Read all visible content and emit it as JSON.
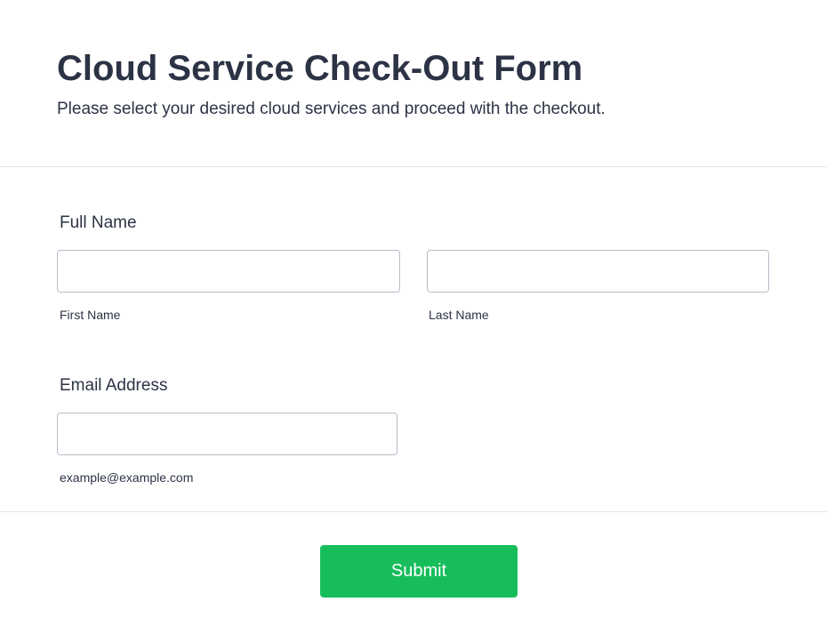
{
  "header": {
    "title": "Cloud Service Check-Out Form",
    "subtitle": "Please select your desired cloud services and proceed with the checkout."
  },
  "full_name": {
    "label": "Full Name",
    "first_name": {
      "value": "",
      "sublabel": "First Name"
    },
    "last_name": {
      "value": "",
      "sublabel": "Last Name"
    }
  },
  "email": {
    "label": "Email Address",
    "value": "",
    "sublabel": "example@example.com"
  },
  "submit": {
    "label": "Submit",
    "color": "#18bd5b"
  }
}
